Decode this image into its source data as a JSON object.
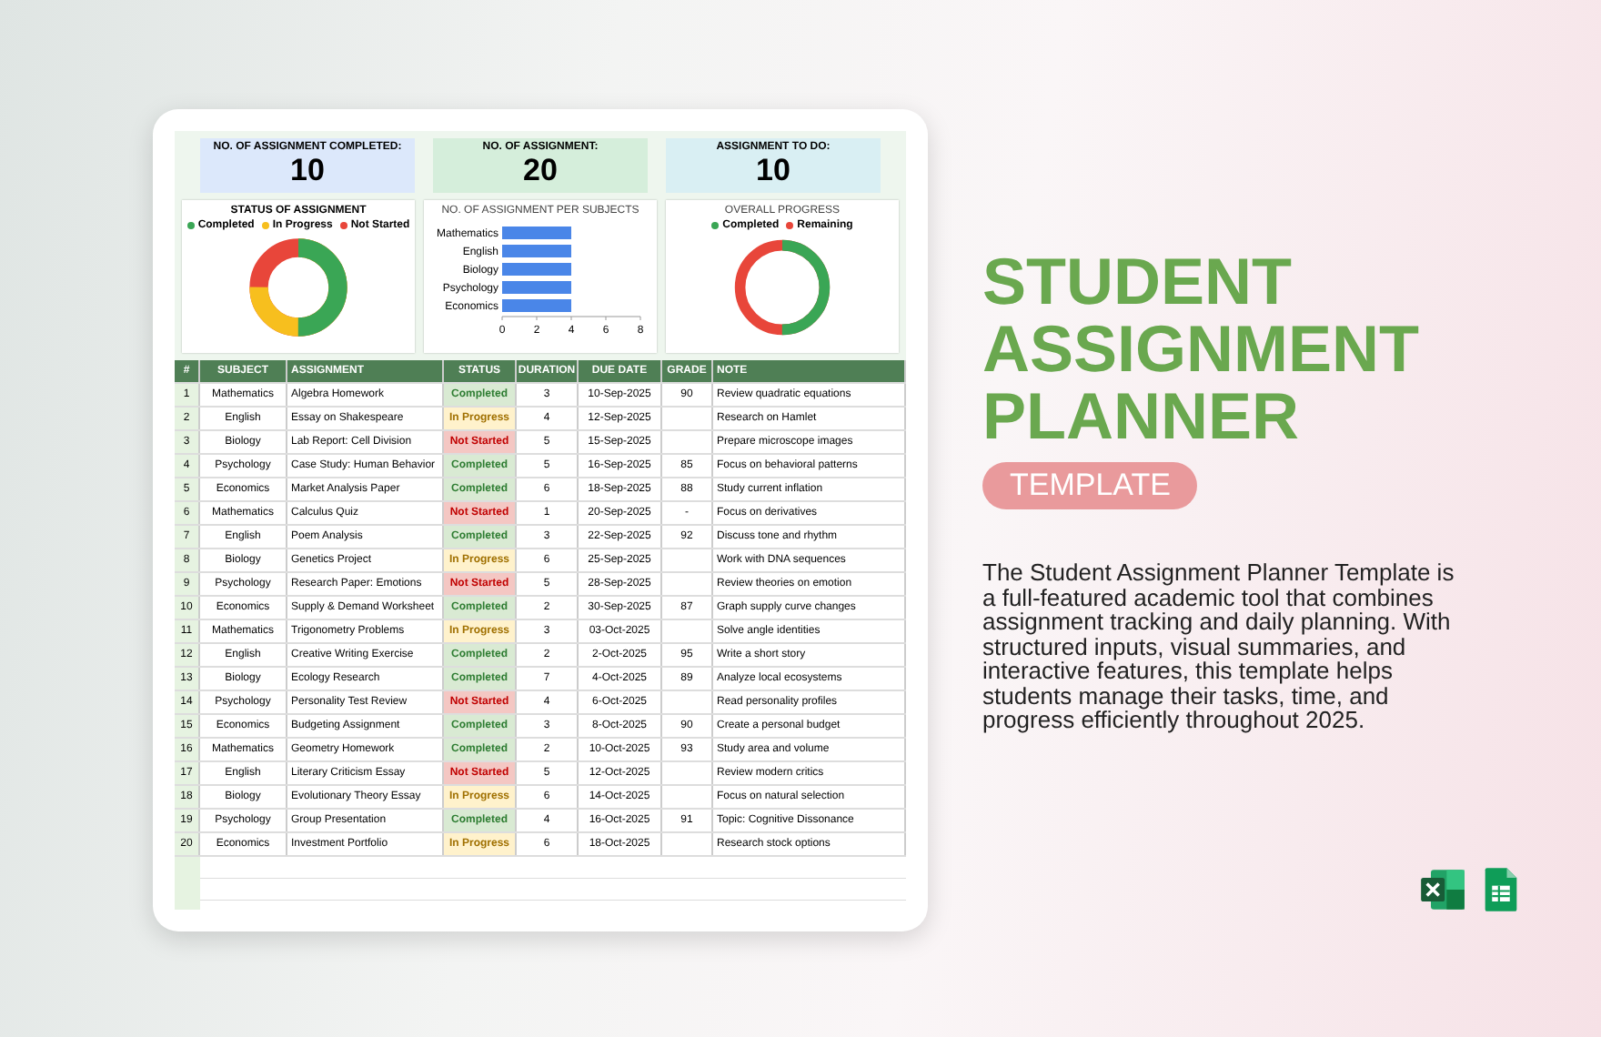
{
  "dashboard": {
    "kpis": [
      {
        "label": "NO. OF ASSIGNMENT COMPLETED:",
        "value": "10",
        "color": "#dce8fb"
      },
      {
        "label": "NO. OF ASSIGNMENT:",
        "value": "20",
        "color": "#d5eedb"
      },
      {
        "label": "ASSIGNMENT TO DO:",
        "value": "10",
        "color": "#d9eff3"
      }
    ],
    "status_chart": {
      "title": "STATUS OF ASSIGNMENT",
      "legend": [
        {
          "label": "Completed",
          "color": "#3aa655"
        },
        {
          "label": "In Progress",
          "color": "#f7bf1e"
        },
        {
          "label": "Not Started",
          "color": "#e8463a"
        }
      ]
    },
    "subject_chart": {
      "title": "NO. OF ASSIGNMENT PER SUBJECTS",
      "chart_data": {
        "type": "bar",
        "orientation": "horizontal",
        "categories": [
          "Mathematics",
          "English",
          "Biology",
          "Psychology",
          "Economics"
        ],
        "series": [
          {
            "color": "#4a86e8",
            "values": [
              4,
              4,
              4,
              4,
              4
            ]
          }
        ],
        "xlim": [
          0,
          8
        ],
        "xticks": [
          0,
          2,
          4,
          6,
          8
        ]
      }
    },
    "progress_chart": {
      "title": "OVERALL PROGRESS",
      "legend": [
        {
          "label": "Completed",
          "color": "#3aa655"
        },
        {
          "label": "Remaining",
          "color": "#e8463a"
        }
      ]
    }
  },
  "table": {
    "columns": [
      "#",
      "SUBJECT",
      "ASSIGNMENT",
      "STATUS",
      "DURATION",
      "DUE DATE",
      "GRADE",
      "NOTE"
    ],
    "rows": [
      [
        "1",
        "Mathematics",
        "Algebra Homework",
        {
          "text": "Completed",
          "kind": "completed"
        },
        "3",
        "10-Sep-2025",
        "90",
        "Review quadratic equations"
      ],
      [
        "2",
        "English",
        "Essay on Shakespeare",
        {
          "text": "In Progress",
          "kind": "in_progress"
        },
        "4",
        "12-Sep-2025",
        "",
        "Research on Hamlet"
      ],
      [
        "3",
        "Biology",
        "Lab Report: Cell Division",
        {
          "text": "Not Started",
          "kind": "not_started"
        },
        "5",
        "15-Sep-2025",
        "",
        "Prepare microscope images"
      ],
      [
        "4",
        "Psychology",
        "Case Study: Human Behavior",
        {
          "text": "Completed",
          "kind": "completed"
        },
        "5",
        "16-Sep-2025",
        "85",
        "Focus on behavioral patterns"
      ],
      [
        "5",
        "Economics",
        "Market Analysis Paper",
        {
          "text": "Completed",
          "kind": "completed"
        },
        "6",
        "18-Sep-2025",
        "88",
        "Study current inflation"
      ],
      [
        "6",
        "Mathematics",
        "Calculus Quiz",
        {
          "text": "Not Started",
          "kind": "not_started"
        },
        "1",
        "20-Sep-2025",
        "-",
        "Focus on derivatives"
      ],
      [
        "7",
        "English",
        "Poem Analysis",
        {
          "text": "Completed",
          "kind": "completed"
        },
        "3",
        "22-Sep-2025",
        "92",
        "Discuss tone and rhythm"
      ],
      [
        "8",
        "Biology",
        "Genetics Project",
        {
          "text": "In Progress",
          "kind": "in_progress"
        },
        "6",
        "25-Sep-2025",
        "",
        "Work with DNA sequences"
      ],
      [
        "9",
        "Psychology",
        "Research Paper: Emotions",
        {
          "text": "Not Started",
          "kind": "not_started"
        },
        "5",
        "28-Sep-2025",
        "",
        "Review theories on emotion"
      ],
      [
        "10",
        "Economics",
        "Supply & Demand Worksheet",
        {
          "text": "Completed",
          "kind": "completed"
        },
        "2",
        "30-Sep-2025",
        "87",
        "Graph supply curve changes"
      ],
      [
        "11",
        "Mathematics",
        "Trigonometry Problems",
        {
          "text": "In Progress",
          "kind": "in_progress"
        },
        "3",
        "03-Oct-2025",
        "",
        "Solve angle identities"
      ],
      [
        "12",
        "English",
        "Creative Writing Exercise",
        {
          "text": "Completed",
          "kind": "completed"
        },
        "2",
        "2-Oct-2025",
        "95",
        "Write a short story"
      ],
      [
        "13",
        "Biology",
        "Ecology Research",
        {
          "text": "Completed",
          "kind": "completed"
        },
        "7",
        "4-Oct-2025",
        "89",
        "Analyze local ecosystems"
      ],
      [
        "14",
        "Psychology",
        "Personality Test Review",
        {
          "text": "Not Started",
          "kind": "not_started"
        },
        "4",
        "6-Oct-2025",
        "",
        "Read personality profiles"
      ],
      [
        "15",
        "Economics",
        "Budgeting Assignment",
        {
          "text": "Completed",
          "kind": "completed"
        },
        "3",
        "8-Oct-2025",
        "90",
        "Create a personal budget"
      ],
      [
        "16",
        "Mathematics",
        "Geometry Homework",
        {
          "text": "Completed",
          "kind": "completed"
        },
        "2",
        "10-Oct-2025",
        "93",
        "Study area and volume"
      ],
      [
        "17",
        "English",
        "Literary Criticism Essay",
        {
          "text": "Not Started",
          "kind": "not_started"
        },
        "5",
        "12-Oct-2025",
        "",
        "Review modern critics"
      ],
      [
        "18",
        "Biology",
        "Evolutionary Theory Essay",
        {
          "text": "In Progress",
          "kind": "in_progress"
        },
        "6",
        "14-Oct-2025",
        "",
        "Focus on natural selection"
      ],
      [
        "19",
        "Psychology",
        "Group Presentation",
        {
          "text": "Completed",
          "kind": "completed"
        },
        "4",
        "16-Oct-2025",
        "91",
        "Topic: Cognitive Dissonance"
      ],
      [
        "20",
        "Economics",
        "Investment Portfolio",
        {
          "text": "In Progress",
          "kind": "in_progress"
        },
        "6",
        "18-Oct-2025",
        "",
        "Research stock options"
      ]
    ]
  },
  "promo": {
    "title": [
      "STUDENT",
      "ASSIGNMENT",
      "PLANNER"
    ],
    "badge": "TEMPLATE",
    "description": "The Student Assignment Planner Template is a full-featured academic tool that combines assignment tracking and daily planning. With structured inputs, visual summaries, and interactive features, this template helps students manage their tasks, time, and progress efficiently throughout 2025."
  }
}
